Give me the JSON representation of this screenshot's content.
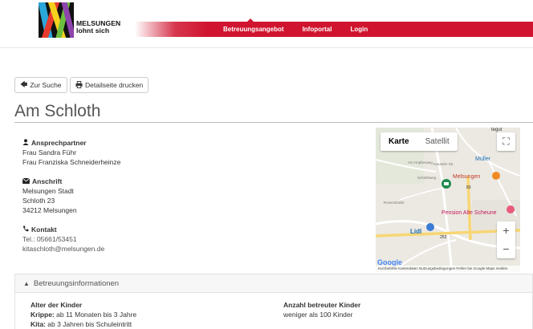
{
  "header": {
    "logo_line1": "MELSUNGEN",
    "logo_line2": "lohnt sich",
    "nav": [
      "Betreuungsangebot",
      "Infoportal",
      "Login"
    ],
    "colors": {
      "brand_red": "#d0142f"
    }
  },
  "toolbar": {
    "back_label": "Zur Suche",
    "print_label": "Detailseite drucken"
  },
  "page": {
    "title": "Am Schloth"
  },
  "contact": {
    "persons_heading": "Ansprechpartner",
    "persons": [
      "Frau Sandra Führ",
      "Frau Franziska Schneiderheinze"
    ],
    "address_heading": "Anschrift",
    "address": [
      "Melsungen Stadt",
      "Schloth 23",
      "34212 Melsungen"
    ],
    "contact_heading": "Kontakt",
    "phone": "Tel.: 05661/53451",
    "email": "kitaschloth@melsungen.de"
  },
  "map": {
    "tab_map": "Karte",
    "tab_satellite": "Satellit",
    "labels": [
      "tegut",
      "Müller",
      "Melsungen",
      "Pension Alte Scheune",
      "Lidl",
      "83",
      "253",
      "Schlothweg",
      "Am Hopfenweg",
      "Kasseler Str.",
      "Rosenstraße"
    ],
    "footer": "Kurzbefehle   Kartendaten   Nutzungsbedingungen   Fehler bei Google Maps melden",
    "google": "Google"
  },
  "info": {
    "heading": "Betreuungsinformationen",
    "age_heading": "Alter der Kinder",
    "krippe_label": "Krippe:",
    "krippe_value": "ab 11 Monaten bis 3 Jahre",
    "kita_label": "Kita:",
    "kita_value": "ab 3 Jahren bis Schuleintritt",
    "count_heading": "Anzahl betreuter Kinder",
    "count_value": "weniger als 100 Kinder"
  }
}
